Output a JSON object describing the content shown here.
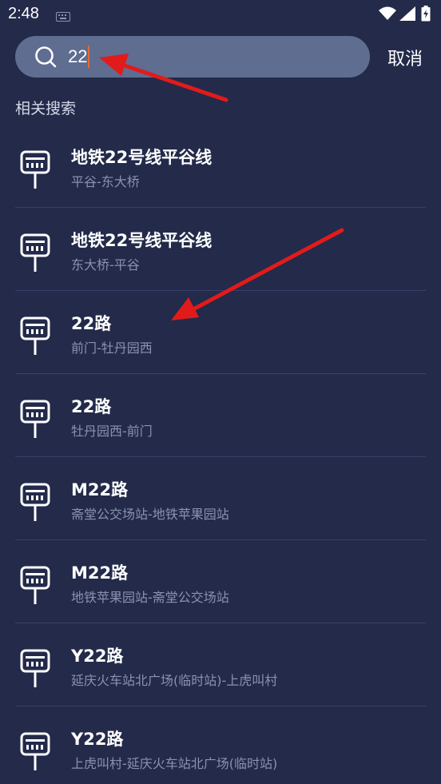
{
  "status_bar": {
    "time": "2:48",
    "icons": [
      "keyboard-icon",
      "wifi-icon",
      "signal-icon",
      "battery-icon"
    ]
  },
  "search": {
    "value": "22",
    "icon": "search-icon",
    "cancel_label": "取消"
  },
  "section": {
    "title": "相关搜索"
  },
  "results": [
    {
      "title": "地铁22号线平谷线",
      "subtitle": "平谷-东大桥",
      "icon": "bus-stop-icon"
    },
    {
      "title": "地铁22号线平谷线",
      "subtitle": "东大桥-平谷",
      "icon": "bus-stop-icon"
    },
    {
      "title": "22路",
      "subtitle": "前门-牡丹园西",
      "icon": "bus-stop-icon"
    },
    {
      "title": "22路",
      "subtitle": "牡丹园西-前门",
      "icon": "bus-stop-icon"
    },
    {
      "title": "M22路",
      "subtitle": "斋堂公交场站-地铁苹果园站",
      "icon": "bus-stop-icon"
    },
    {
      "title": "M22路",
      "subtitle": "地铁苹果园站-斋堂公交场站",
      "icon": "bus-stop-icon"
    },
    {
      "title": "Y22路",
      "subtitle": "延庆火车站北广场(临时站)-上虎叫村",
      "icon": "bus-stop-icon"
    },
    {
      "title": "Y22路",
      "subtitle": "上虎叫村-延庆火车站北广场(临时站)",
      "icon": "bus-stop-icon"
    }
  ],
  "colors": {
    "background": "#232a4a",
    "search_box": "#5e6d90",
    "caret": "#e8692f",
    "subtitle": "#8a92b2",
    "divider": "#39406a",
    "annotation_arrow": "#e11b1b"
  }
}
